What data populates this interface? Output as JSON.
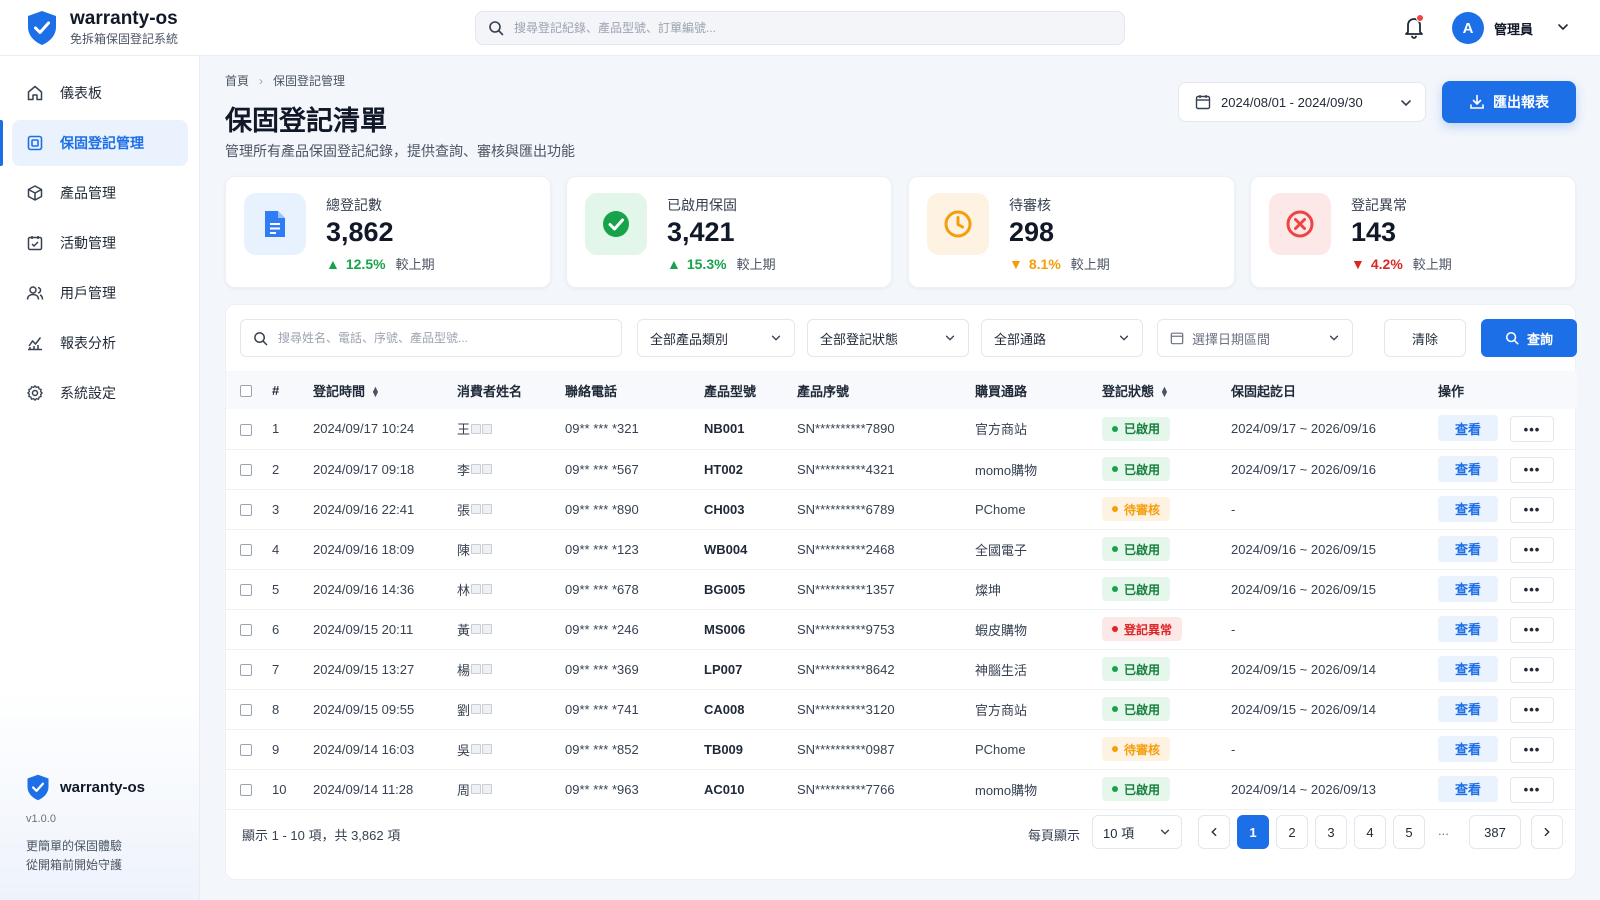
{
  "app": {
    "name": "warranty-os",
    "subtitle": "免拆箱保固登記系統",
    "search_placeholder": "搜尋登記紀錄、產品型號、訂單編號...",
    "user_initial": "A",
    "user_name": "管理員"
  },
  "sidebar": {
    "items": [
      {
        "label": "儀表板",
        "icon": "home-icon",
        "active": false
      },
      {
        "label": "保固登記管理",
        "icon": "registration-icon",
        "active": true
      },
      {
        "label": "產品管理",
        "icon": "box-icon",
        "active": false
      },
      {
        "label": "活動管理",
        "icon": "calendar-check-icon",
        "active": false
      },
      {
        "label": "用戶管理",
        "icon": "users-icon",
        "active": false
      },
      {
        "label": "報表分析",
        "icon": "chart-icon",
        "active": false
      },
      {
        "label": "系統設定",
        "icon": "gear-icon",
        "active": false
      }
    ],
    "footer": {
      "name": "warranty-os",
      "version": "v1.0.0",
      "tagline1": "更簡單的保固體驗",
      "tagline2": "從開箱前開始守護"
    }
  },
  "header": {
    "breadcrumb_home": "首頁",
    "breadcrumb_current": "保固登記管理",
    "title": "保固登記清單",
    "subtitle": "管理所有產品保固登記紀錄，提供查詢、審核與匯出功能",
    "date_range": "2024/08/01 - 2024/09/30",
    "export_label": "匯出報表"
  },
  "stats": [
    {
      "label": "總登記數",
      "value": "3,862",
      "delta": "12.5%",
      "direction": "up",
      "compare": "較上期",
      "color": "#2f7cf6",
      "bg": "#e8f1fe"
    },
    {
      "label": "已啟用保固",
      "value": "3,421",
      "delta": "15.3%",
      "direction": "up",
      "compare": "較上期",
      "color": "#16a34a",
      "bg": "#e3f6ea"
    },
    {
      "label": "待審核",
      "value": "298",
      "delta": "8.1%",
      "direction": "down",
      "compare": "較上期",
      "color": "#f59e0b",
      "bg": "#fef3e2"
    },
    {
      "label": "登記異常",
      "value": "143",
      "delta": "4.2%",
      "direction": "down",
      "compare": "較上期",
      "color": "#ef4444",
      "bg": "#fde8e8"
    }
  ],
  "filters": {
    "search_placeholder": "搜尋姓名、電話、序號、產品型號...",
    "category": "全部產品類別",
    "status": "全部登記狀態",
    "channel": "全部通路",
    "date_placeholder": "選擇日期區間",
    "clear_label": "清除",
    "query_label": "查詢"
  },
  "table": {
    "columns": [
      "#",
      "登記時間",
      "消費者姓名",
      "聯絡電話",
      "產品型號",
      "產品序號",
      "購買通路",
      "登記狀態",
      "保固起訖日",
      "操作"
    ],
    "view_label": "查看",
    "more_label": "•••",
    "rows": [
      {
        "no": "1",
        "time": "2024/09/17 10:24",
        "name": "王",
        "phone": "09** *** *321",
        "model": "NB001",
        "serial": "SN**********7890",
        "channel": "官方商站",
        "status": "已啟用",
        "status_type": "ok",
        "period": "2024/09/17 ~ 2026/09/16"
      },
      {
        "no": "2",
        "time": "2024/09/17 09:18",
        "name": "李",
        "phone": "09** *** *567",
        "model": "HT002",
        "serial": "SN**********4321",
        "channel": "momo購物",
        "status": "已啟用",
        "status_type": "ok",
        "period": "2024/09/17 ~ 2026/09/16"
      },
      {
        "no": "3",
        "time": "2024/09/16 22:41",
        "name": "張",
        "phone": "09** *** *890",
        "model": "CH003",
        "serial": "SN**********6789",
        "channel": "PChome",
        "status": "待審核",
        "status_type": "pend",
        "period": "-"
      },
      {
        "no": "4",
        "time": "2024/09/16 18:09",
        "name": "陳",
        "phone": "09** *** *123",
        "model": "WB004",
        "serial": "SN**********2468",
        "channel": "全國電子",
        "status": "已啟用",
        "status_type": "ok",
        "period": "2024/09/16 ~ 2026/09/15"
      },
      {
        "no": "5",
        "time": "2024/09/16 14:36",
        "name": "林",
        "phone": "09** *** *678",
        "model": "BG005",
        "serial": "SN**********1357",
        "channel": "燦坤",
        "status": "已啟用",
        "status_type": "ok",
        "period": "2024/09/16 ~ 2026/09/15"
      },
      {
        "no": "6",
        "time": "2024/09/15 20:11",
        "name": "黃",
        "phone": "09** *** *246",
        "model": "MS006",
        "serial": "SN**********9753",
        "channel": "蝦皮購物",
        "status": "登記異常",
        "status_type": "err",
        "period": "-"
      },
      {
        "no": "7",
        "time": "2024/09/15 13:27",
        "name": "楊",
        "phone": "09** *** *369",
        "model": "LP007",
        "serial": "SN**********8642",
        "channel": "神腦生活",
        "status": "已啟用",
        "status_type": "ok",
        "period": "2024/09/15 ~ 2026/09/14"
      },
      {
        "no": "8",
        "time": "2024/09/15 09:55",
        "name": "劉",
        "phone": "09** *** *741",
        "model": "CA008",
        "serial": "SN**********3120",
        "channel": "官方商站",
        "status": "已啟用",
        "status_type": "ok",
        "period": "2024/09/15 ~ 2026/09/14"
      },
      {
        "no": "9",
        "time": "2024/09/14 16:03",
        "name": "吳",
        "phone": "09** *** *852",
        "model": "TB009",
        "serial": "SN**********0987",
        "channel": "PChome",
        "status": "待審核",
        "status_type": "pend",
        "period": "-"
      },
      {
        "no": "10",
        "time": "2024/09/14 11:28",
        "name": "周",
        "phone": "09** *** *963",
        "model": "AC010",
        "serial": "SN**********7766",
        "channel": "momo購物",
        "status": "已啟用",
        "status_type": "ok",
        "period": "2024/09/14 ~ 2026/09/13"
      }
    ]
  },
  "pagination": {
    "info": "顯示 1 - 10 項，共 3,862 項",
    "per_page_label": "每頁顯示",
    "per_page_value": "10 項",
    "pages": [
      "1",
      "2",
      "3",
      "4",
      "5"
    ],
    "current": "1",
    "ellipsis": "...",
    "last": "387"
  }
}
